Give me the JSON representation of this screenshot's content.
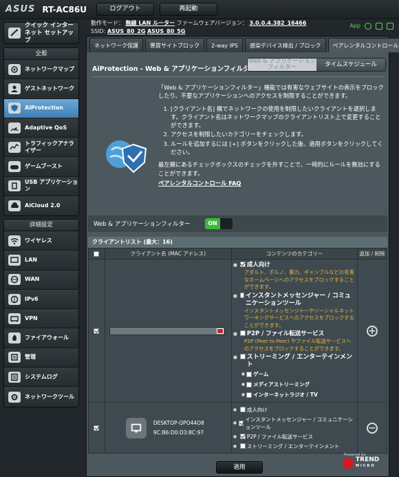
{
  "header": {
    "brand": "ASUS",
    "model": "RT-AC86U",
    "logout_label": "ログアウト",
    "reboot_label": "再起動",
    "mode_label": "動作モード：",
    "mode_value": "無線 LAN ルーター",
    "fw_label": "ファームウェアバージョン：",
    "fw_value": "3.0.0.4.382_16466",
    "ssid_label": "SSID:",
    "ssid_1": "ASUS_80_2G",
    "ssid_2": "ASUS_80_5G",
    "app_label": "App"
  },
  "sidebar": {
    "qis_label": "クイック インターネット セットアップ",
    "general_header": "全般",
    "general_items": [
      {
        "label": "ネットワークマップ",
        "icon": "network-map-icon"
      },
      {
        "label": "ゲストネットワーク",
        "icon": "guest-network-icon"
      },
      {
        "label": "AiProtection",
        "icon": "aiprotection-icon"
      },
      {
        "label": "Adaptive QoS",
        "icon": "qos-icon"
      },
      {
        "label": "トラフィックアナライザー",
        "icon": "traffic-analyzer-icon"
      },
      {
        "label": "ゲームブースト",
        "icon": "gamepad-icon"
      },
      {
        "label": "USB アプリケーション",
        "icon": "usb-icon"
      },
      {
        "label": "AiCloud 2.0",
        "icon": "cloud-icon"
      }
    ],
    "advanced_header": "詳細設定",
    "advanced_items": [
      {
        "label": "ワイヤレス",
        "icon": "wireless-icon"
      },
      {
        "label": "LAN",
        "icon": "lan-icon"
      },
      {
        "label": "WAN",
        "icon": "wan-icon"
      },
      {
        "label": "IPv6",
        "icon": "ipv6-icon"
      },
      {
        "label": "VPN",
        "icon": "vpn-icon"
      },
      {
        "label": "ファイアウォール",
        "icon": "firewall-icon"
      },
      {
        "label": "管理",
        "icon": "admin-icon"
      },
      {
        "label": "システムログ",
        "icon": "system-log-icon"
      },
      {
        "label": "ネットワークツール",
        "icon": "network-tools-icon"
      }
    ]
  },
  "tabs": [
    "ネットワーク保護",
    "悪質サイトブロック",
    "2-way IPS",
    "感染デバイス検出 / ブロック",
    "ペアレンタルコントロール"
  ],
  "page": {
    "title": "AiProtection - Web & アプリケーションフィルター",
    "seg_1": "Web & アプリケーション フィルター",
    "seg_2": "タイムスケジュール",
    "intro": "「Web & アプリケーションフィルター」機能では有害なウェブサイトの表示をブロックしたり、不要なアプリケーションへのアクセスを制限することができます。",
    "steps": [
      "[クライアント名] 欄でネットワークの使用を制限したいクライアントを選択します。クライアント名はネットワークマップのクライアントリスト上で変更することができます。",
      "アクセスを制限したいカテゴリーをチェックします。",
      "ルールを追加するには [+] ボタンをクリックした後、適用ボタンをクリックしてください。"
    ],
    "note": "最左欄にあるチェックボックスのチェックを外すことで、一時的にルールを無効にすることができます。",
    "faq_link": "ペアレンタルコントロール FAQ",
    "filter_label": "Web & アプリケーションフィルター",
    "toggle_on": "ON"
  },
  "client_list": {
    "caption": "クライアントリスト (最大：16)",
    "col_client": "クライアント名 (MAC アドレス)",
    "col_category": "コンテンツのカテゴリー",
    "col_action": "追加 / 削除",
    "categories": [
      {
        "name": "成人向け",
        "checked": true,
        "desc": "アダルト、ポルノ、暴力、ギャンブルなどの有害なホームページへのアクセスをブロックすることができます。"
      },
      {
        "name": "インスタントメッセンジャー / コミュニケーションツール",
        "checked": false,
        "desc": "インスタントメッセンジャーやソーシャルネットワーキングサービスへのアクセスをブロックすることができます。"
      },
      {
        "name": "P2P / ファイル転送サービス",
        "checked": false,
        "desc": "P2P (Peer to Peer) やファイル転送サービスへのアクセスをブロックすることができます。"
      },
      {
        "name": "ストリーミング / エンターテインメント",
        "checked": false,
        "desc": ""
      }
    ],
    "streaming_subs": [
      "ゲーム",
      "メディアストリーミング",
      "インターネットラジオ / TV"
    ],
    "device_name": "DESKTOP-OPO44O8",
    "device_mac": "9C:B6:D0:D3:8C:97",
    "device_categories": [
      {
        "name": "成人向け",
        "checked": false
      },
      {
        "name": "インスタントメッセンジャー / コミュニケーションツール",
        "checked": true
      },
      {
        "name": "P2P / ファイル転送サービス",
        "checked": true
      },
      {
        "name": "ストリーミング / エンターテインメント",
        "checked": false
      }
    ]
  },
  "apply_label": "適用",
  "trend": {
    "powered": "Powered by",
    "brand": "TREND",
    "sub": "MICRO"
  }
}
